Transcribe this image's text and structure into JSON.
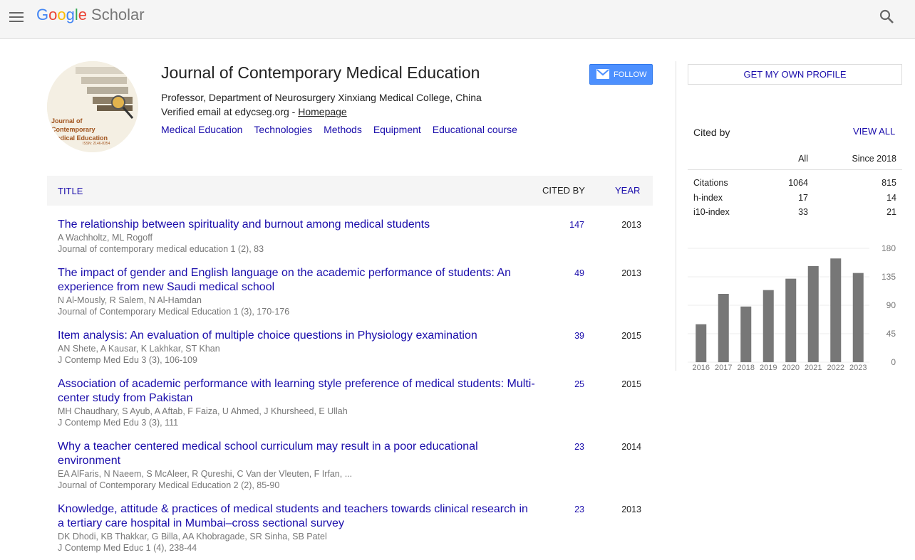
{
  "header": {
    "logo_letters": [
      "G",
      "o",
      "o",
      "g",
      "l",
      "e"
    ],
    "logo_suffix": "Scholar",
    "icons": [
      "menu-icon",
      "search-icon"
    ]
  },
  "profile": {
    "name": "Journal of Contemporary Medical Education",
    "affiliation": "Professor, Department of Neurosurgery Xinxiang Medical College, China",
    "verified_prefix": "Verified email at edycseg.org - ",
    "homepage_label": "Homepage",
    "interests": [
      "Medical Education",
      "Technologies",
      "Methods",
      "Equipment",
      "Educational course"
    ],
    "avatar_text": [
      "Journal of",
      "Contemporary",
      "Medical Education"
    ],
    "avatar_issn": "ISSN: 2146-8354",
    "follow_label": "FOLLOW"
  },
  "table": {
    "col_title": "TITLE",
    "col_cited": "CITED BY",
    "col_year": "YEAR",
    "rows": [
      {
        "title": "The relationship between spirituality and burnout among medical students",
        "authors": "A Wachholtz, ML Rogoff",
        "venue": "Journal of contemporary medical education 1 (2), 83",
        "cited": "147",
        "year": "2013"
      },
      {
        "title": "The impact of gender and English language on the academic performance of students: An experience from new Saudi medical school",
        "authors": "N Al-Mously, R Salem, N Al-Hamdan",
        "venue": "Journal of Contemporary Medical Education 1 (3), 170-176",
        "cited": "49",
        "year": "2013"
      },
      {
        "title": "Item analysis: An evaluation of multiple choice questions in Physiology examination",
        "authors": "AN Shete, A Kausar, K Lakhkar, ST Khan",
        "venue": "J Contemp Med Edu 3 (3), 106-109",
        "cited": "39",
        "year": "2015"
      },
      {
        "title": "Association of academic performance with learning style preference of medical students: Multi-center study from Pakistan",
        "authors": "MH Chaudhary, S Ayub, A Aftab, F Faiza, U Ahmed, J Khursheed, E Ullah",
        "venue": "J Contemp Med Edu 3 (3), 111",
        "cited": "25",
        "year": "2015"
      },
      {
        "title": "Why a teacher centered medical school curriculum may result in a poor educational environment",
        "authors": "EA AlFaris, N Naeem, S McAleer, R Qureshi, C Van der Vleuten, F Irfan, ...",
        "venue": "Journal of Contemporary Medical Education 2 (2), 85-90",
        "cited": "23",
        "year": "2014"
      },
      {
        "title": "Knowledge, attitude & practices of medical students and teachers towards clinical research in a tertiary care hospital in Mumbai–cross sectional survey",
        "authors": "DK Dhodi, KB Thakkar, G Billa, AA Khobragade, SR Sinha, SB Patel",
        "venue": "J Contemp Med Educ 1 (4), 238-44",
        "cited": "23",
        "year": "2013"
      }
    ]
  },
  "sidebar": {
    "own_profile_label": "GET MY OWN PROFILE",
    "cited_by_label": "Cited by",
    "view_all_label": "VIEW ALL",
    "col_all": "All",
    "col_since": "Since 2018",
    "stats": [
      {
        "label": "Citations",
        "all": "1064",
        "since": "815"
      },
      {
        "label": "h-index",
        "all": "17",
        "since": "14"
      },
      {
        "label": "i10-index",
        "all": "33",
        "since": "21"
      }
    ]
  },
  "chart_data": {
    "type": "bar",
    "categories": [
      "2016",
      "2017",
      "2018",
      "2019",
      "2020",
      "2021",
      "2022",
      "2023"
    ],
    "values": [
      60,
      108,
      88,
      114,
      132,
      152,
      164,
      141
    ],
    "yticks": [
      "180",
      "135",
      "90",
      "45",
      "0"
    ],
    "ylim": [
      0,
      180
    ],
    "bar_color": "#777777",
    "grid": true
  },
  "colors": {
    "link": "#1a0dab",
    "follow_bg": "#4d90fe"
  }
}
